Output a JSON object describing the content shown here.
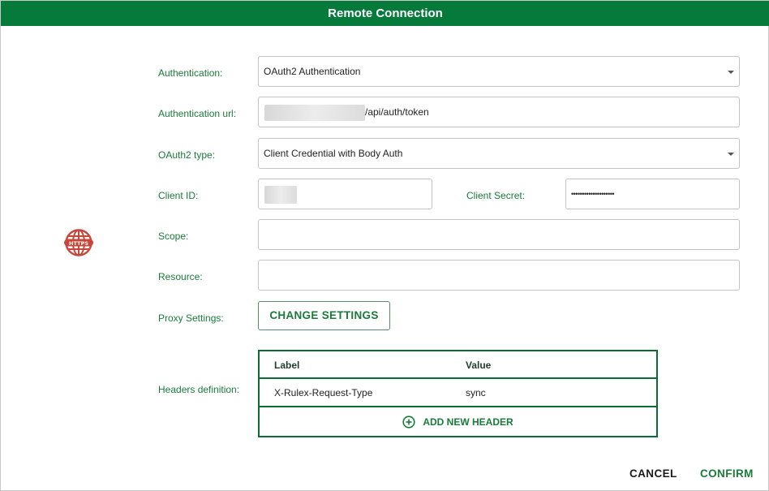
{
  "dialog": {
    "title": "Remote Connection",
    "icon": "https-globe-icon",
    "accent_color": "#057a3a",
    "icon_color": "#c8453a"
  },
  "form": {
    "authentication": {
      "label": "Authentication:",
      "value": "OAuth2 Authentication"
    },
    "auth_url": {
      "label": "Authentication url:",
      "value": "/api/auth/token"
    },
    "oauth2_type": {
      "label": "OAuth2 type:",
      "value": "Client Credential with Body Auth"
    },
    "client_id": {
      "label": "Client ID:",
      "value": ""
    },
    "client_secret": {
      "label": "Client Secret:",
      "value": "••••••••••••••••••••"
    },
    "scope": {
      "label": "Scope:",
      "value": ""
    },
    "resource": {
      "label": "Resource:",
      "value": ""
    },
    "proxy": {
      "label": "Proxy Settings:",
      "button": "CHANGE SETTINGS"
    },
    "headers": {
      "label": "Headers definition:",
      "columns": [
        "Label",
        "Value"
      ],
      "rows": [
        {
          "label": "X-Rulex-Request-Type",
          "value": "sync"
        }
      ],
      "add_label": "ADD NEW HEADER"
    }
  },
  "footer": {
    "cancel": "CANCEL",
    "confirm": "CONFIRM"
  }
}
